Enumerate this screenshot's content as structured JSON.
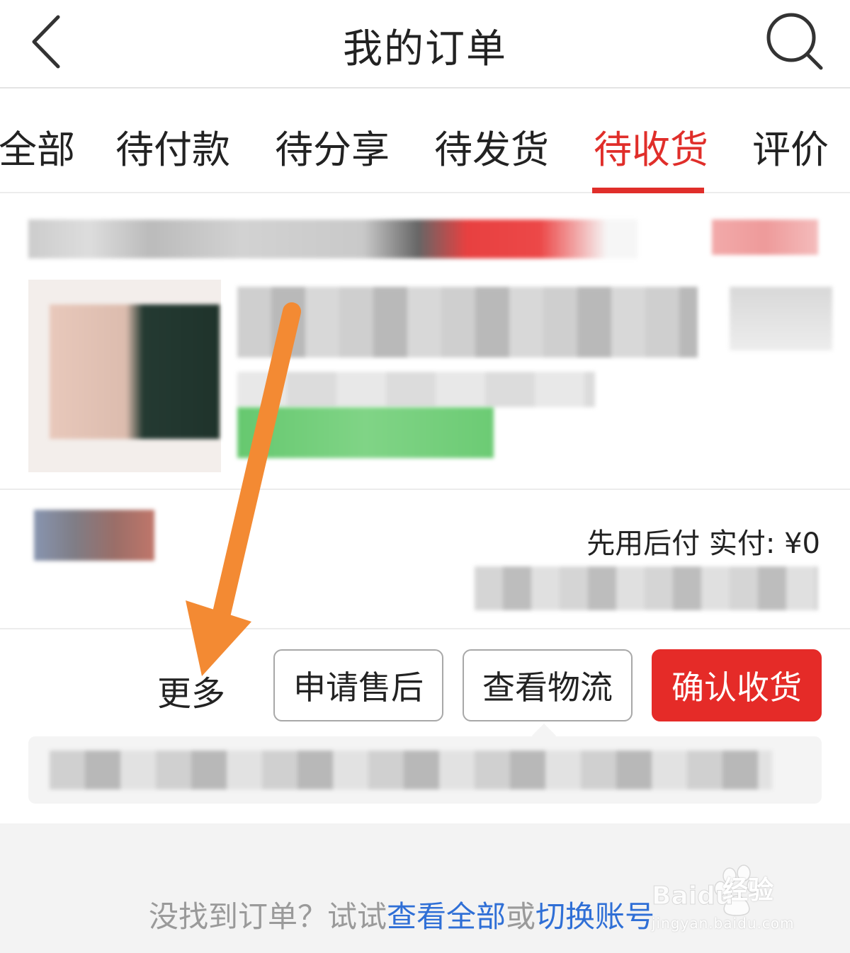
{
  "header": {
    "title": "我的订单",
    "back_icon": "chevron-left-icon",
    "search_icon": "search-icon"
  },
  "tabs": [
    {
      "label": "全部",
      "active": false
    },
    {
      "label": "待付款",
      "active": false
    },
    {
      "label": "待分享",
      "active": false
    },
    {
      "label": "待发货",
      "active": false
    },
    {
      "label": "待收货",
      "active": true
    },
    {
      "label": "评价",
      "active": false
    }
  ],
  "order": {
    "payment_label": "先用后付 实付: ¥0",
    "more_label": "更多",
    "buttons": {
      "aftersale": "申请售后",
      "logistics": "查看物流",
      "confirm": "确认收货"
    }
  },
  "footer": {
    "prefix": "没找到订单？试试",
    "link_all": "查看全部",
    "middle": "或",
    "link_switch": "切换账号"
  },
  "watermark": {
    "brand": "Baidu",
    "text": "经验",
    "url": "jingyan.baidu.com"
  },
  "colors": {
    "accent": "#e02e2a",
    "confirm_button": "#e52b28",
    "link": "#2f6fd6",
    "annotation_arrow": "#f38a33"
  }
}
